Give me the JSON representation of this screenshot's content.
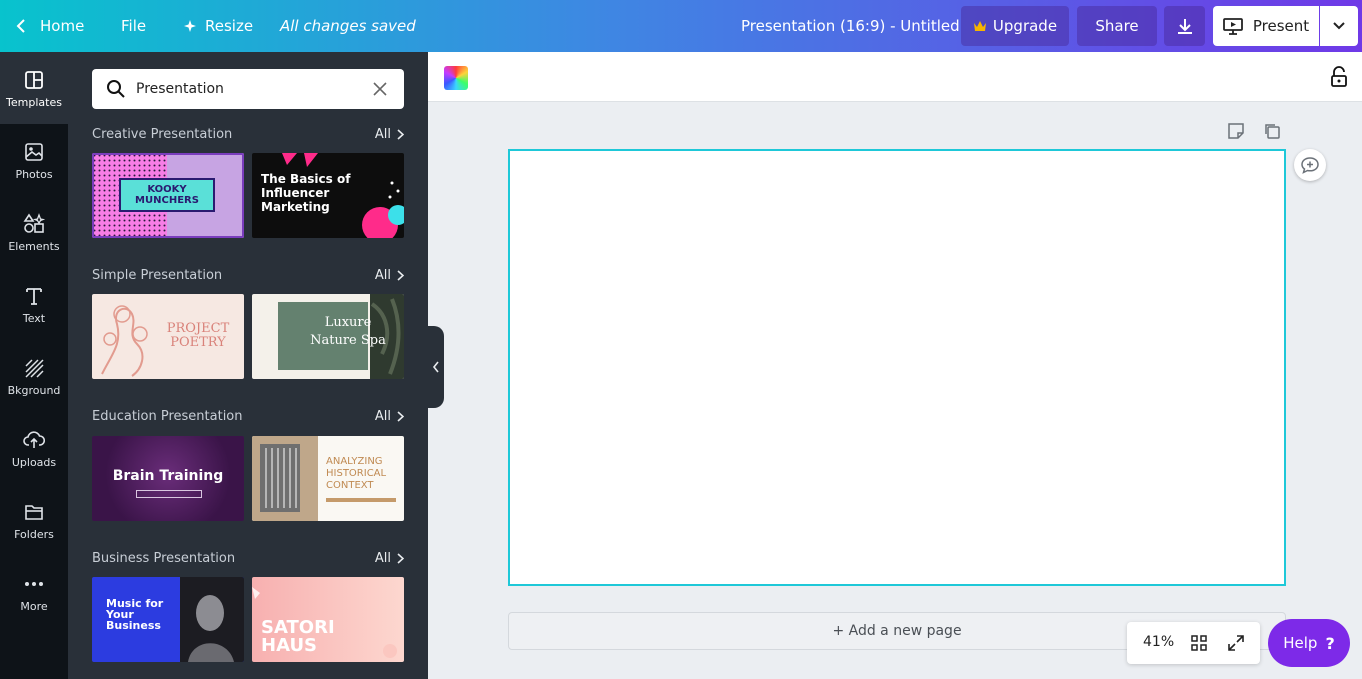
{
  "topbar": {
    "home": "Home",
    "file": "File",
    "resize": "Resize",
    "status": "All changes saved",
    "doc_title": "Presentation (16:9) - Untitled",
    "upgrade": "Upgrade",
    "share": "Share",
    "present": "Present"
  },
  "rail": [
    {
      "label": "Templates",
      "icon": "templates-icon"
    },
    {
      "label": "Photos",
      "icon": "photos-icon"
    },
    {
      "label": "Elements",
      "icon": "elements-icon"
    },
    {
      "label": "Text",
      "icon": "text-icon"
    },
    {
      "label": "Bkground",
      "icon": "background-icon"
    },
    {
      "label": "Uploads",
      "icon": "uploads-icon"
    },
    {
      "label": "Folders",
      "icon": "folders-icon"
    },
    {
      "label": "More",
      "icon": "more-icon"
    }
  ],
  "search": {
    "value": "Presentation"
  },
  "sections": [
    {
      "title": "Creative Presentation",
      "all": "All",
      "templates": [
        {
          "title": "KOOKY MUNCHERS"
        },
        {
          "title": "The Basics of Influencer Marketing"
        }
      ]
    },
    {
      "title": "Simple Presentation",
      "all": "All",
      "templates": [
        {
          "title": "PROJECT POETRY"
        },
        {
          "title": "Luxure Nature Spa"
        }
      ]
    },
    {
      "title": "Education Presentation",
      "all": "All",
      "templates": [
        {
          "title": "Brain Training"
        },
        {
          "title": "ANALYZING HISTORICAL CONTEXT"
        }
      ]
    },
    {
      "title": "Business Presentation",
      "all": "All",
      "templates": [
        {
          "title": "Music for Your Business"
        },
        {
          "title": "SATORI HAUS"
        }
      ]
    }
  ],
  "canvas": {
    "add_page": "+ Add a new page",
    "zoom": "41%",
    "help": "Help"
  },
  "colors": {
    "accent": "#7d2ae8",
    "page_border": "#1ec8d8",
    "panel": "#293039",
    "rail": "#0e1318"
  }
}
